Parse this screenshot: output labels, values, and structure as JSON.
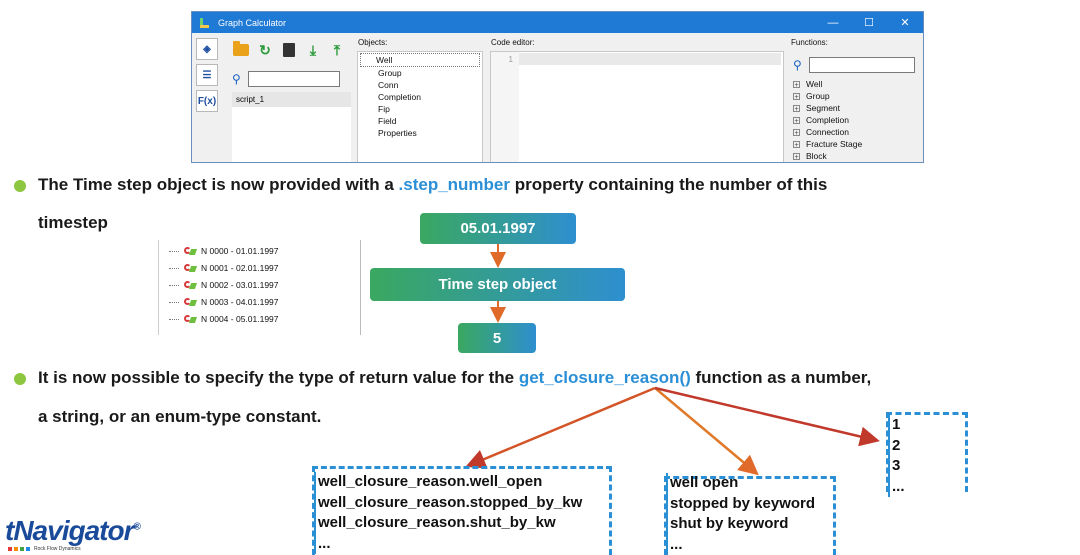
{
  "window": {
    "title": "Graph Calculator",
    "left_buttons": [
      "",
      "",
      "F(x)"
    ],
    "objects_label": "Objects:",
    "objects": [
      "Well",
      "Group",
      "Conn",
      "Completion",
      "Fip",
      "Field",
      "Properties"
    ],
    "code_editor_label": "Code editor:",
    "editor_line_number": "1",
    "functions_label": "Functions:",
    "functions": [
      "Well",
      "Group",
      "Segment",
      "Completion",
      "Connection",
      "Fracture Stage",
      "Block"
    ],
    "script_item": "script_1"
  },
  "bullet1": {
    "text_before": "The Time step object is now provided with a ",
    "highlight": ".step_number",
    "text_after": " property containing the number of this",
    "line2": "timestep"
  },
  "timesteps": [
    "N 0000 - 01.01.1997",
    "N 0001 - 02.01.1997",
    "N 0002 - 03.01.1997",
    "N 0003 - 04.01.1997",
    "N 0004 - 05.01.1997"
  ],
  "flow": {
    "date": "05.01.1997",
    "object": "Time step object",
    "number": "5"
  },
  "bullet2": {
    "text_before": "It is now possible to specify the type of return value for the ",
    "highlight": "get_closure_reason()",
    "text_after": " function as a number,",
    "line2": "a string, or an enum-type constant."
  },
  "enum_box": [
    "well_closure_reason.well_open",
    "well_closure_reason.stopped_by_kw",
    "well_closure_reason.shut_by_kw",
    "..."
  ],
  "string_box": [
    "well open",
    "stopped by keyword",
    "shut by keyword",
    "..."
  ],
  "number_box": [
    "1",
    "2",
    "3",
    "..."
  ],
  "logo": {
    "name": "tNavigator",
    "mark": "®",
    "tagline": "Rock Flow Dynamics"
  },
  "colors": {
    "accent": "#2a8fd6",
    "bullet": "#8dc63f",
    "arrow": "#e06a2a",
    "titlebar": "#1f7ad6"
  }
}
